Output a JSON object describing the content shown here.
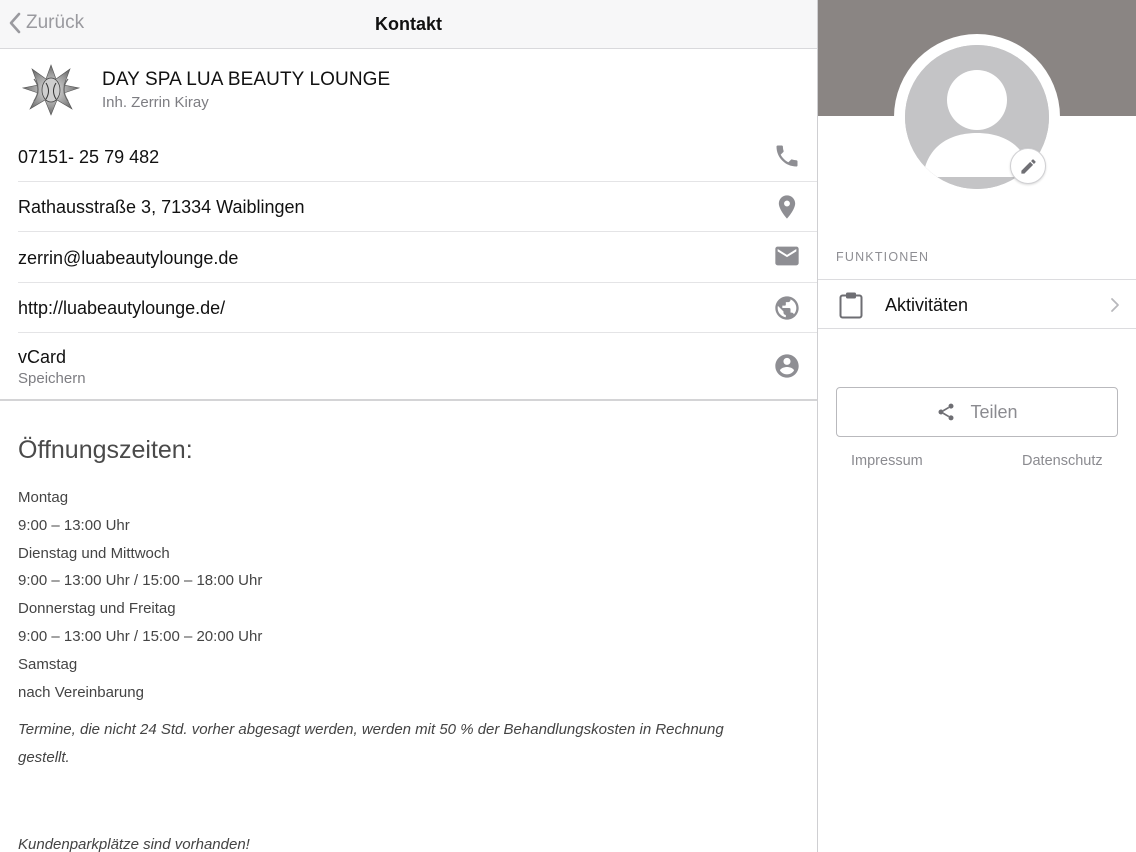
{
  "navbar": {
    "back_label": "Zurück",
    "title": "Kontakt"
  },
  "company": {
    "name": "DAY SPA LUA BEAUTY LOUNGE",
    "owner": "Inh. Zerrin Kiray"
  },
  "contact": {
    "phone": "07151- 25 79 482",
    "address": "Rathausstraße 3, 71334 Waiblingen",
    "email": "zerrin@luabeautylounge.de",
    "website": "http://luabeautylounge.de/",
    "vcard_title": "vCard",
    "vcard_sub": "Speichern"
  },
  "hours": {
    "title": "Öffnungszeiten:",
    "lines": [
      "Montag",
      "9:00 – 13:00 Uhr",
      "Dienstag und Mittwoch",
      "9:00 – 13:00 Uhr / 15:00 – 18:00 Uhr",
      "Donnerstag und Freitag",
      "9:00 – 13:00 Uhr / 15:00 – 20:00 Uhr",
      "Samstag",
      "nach Vereinbarung"
    ],
    "note": "Termine, die nicht 24 Std. vorher abgesagt werden, werden mit 50 % der Behandlungskosten in Rechnung gestellt.",
    "parking": "Kundenparkplätze sind vorhanden!"
  },
  "sidebar": {
    "functions_label": "FUNKTIONEN",
    "activities_label": "Aktivitäten",
    "share_label": "Teilen",
    "imprint_label": "Impressum",
    "privacy_label": "Datenschutz"
  },
  "colors": {
    "cover": "#8a8583",
    "icon_gray": "#8e8e93",
    "navbar_bg": "#f7f7f8"
  }
}
